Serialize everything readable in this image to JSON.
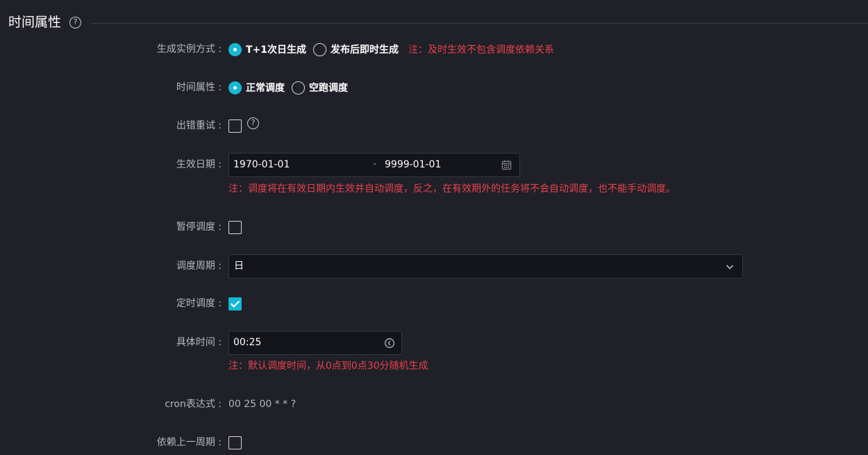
{
  "section": {
    "title": "时间属性"
  },
  "form": {
    "instance_mode": {
      "label": "生成实例方式 :",
      "options": [
        "T+1次日生成",
        "发布后即时生成"
      ],
      "selected": "T+1次日生成",
      "note": "注：及时生效不包含调度依赖关系"
    },
    "time_attr": {
      "label": "时间属性 :",
      "options": [
        "正常调度",
        "空跑调度"
      ],
      "selected": "正常调度"
    },
    "retry": {
      "label": "出错重试 :",
      "checked": false
    },
    "effective_date": {
      "label": "生效日期 :",
      "start": "1970-01-01",
      "separator": "-",
      "end": "9999-01-01",
      "note": "注：调度将在有效日期内生效并自动调度，反之，在有效期外的任务将不会自动调度，也不能手动调度。"
    },
    "pause": {
      "label": "暂停调度 :",
      "checked": false
    },
    "cycle": {
      "label": "调度周期 :",
      "value": "日"
    },
    "timed": {
      "label": "定时调度 :",
      "checked": true
    },
    "specific_time": {
      "label": "具体时间 :",
      "value": "00:25",
      "note": "注：默认调度时间，从0点到0点30分随机生成"
    },
    "cron": {
      "label": "cron表达式 :",
      "value": "00 25 00 * * ?"
    },
    "depend_prev": {
      "label": "依赖上一周期 :",
      "checked": false
    }
  },
  "icons": {
    "help": "help-circle-icon",
    "calendar": "calendar-icon",
    "chevron": "chevron-down-icon",
    "clock": "clock-icon"
  },
  "colors": {
    "background": "#1f2028",
    "accent": "#14b8d4",
    "warning": "#e8424c",
    "input_bg": "#14151b"
  }
}
